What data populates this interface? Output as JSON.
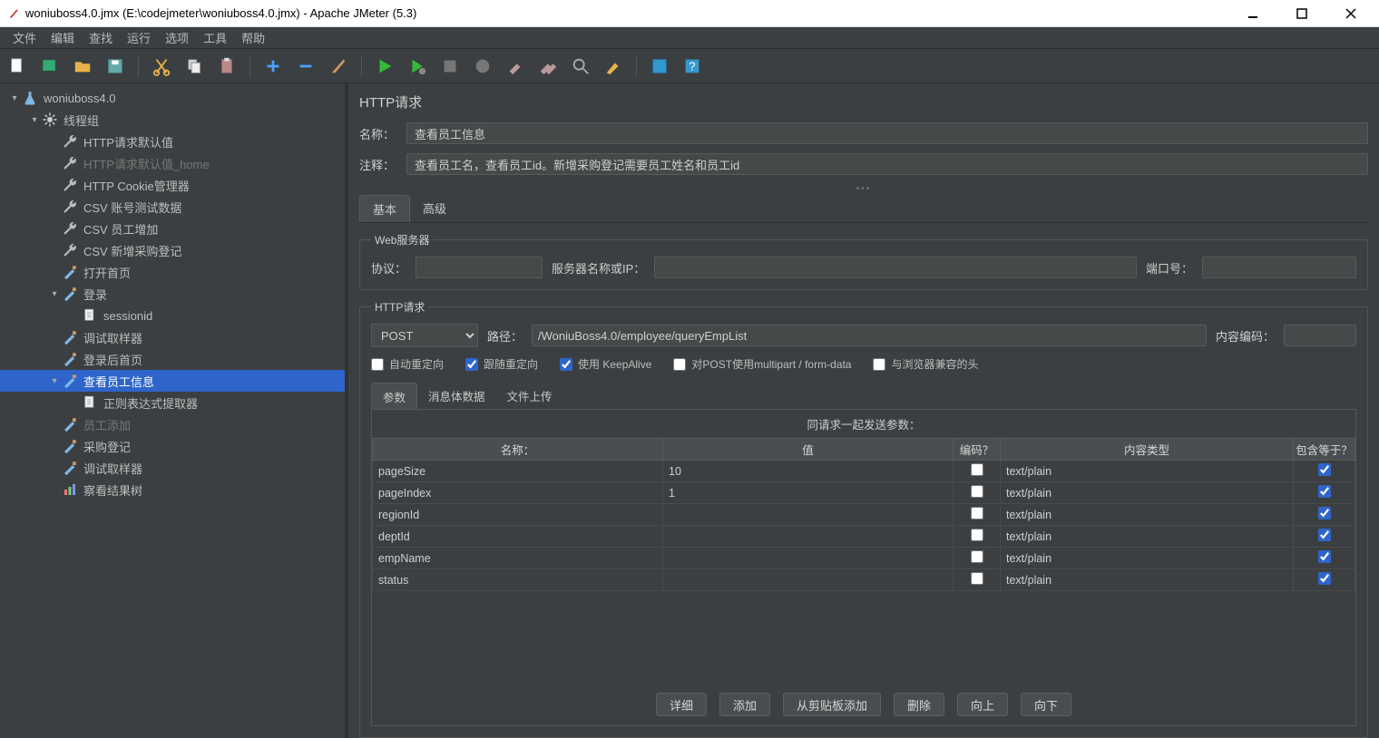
{
  "window": {
    "title": "woniuboss4.0.jmx (E:\\codejmeter\\woniuboss4.0.jmx) - Apache JMeter (5.3)"
  },
  "menu": {
    "items": [
      "文件",
      "编辑",
      "查找",
      "运行",
      "选项",
      "工具",
      "帮助"
    ]
  },
  "tree": {
    "items": [
      {
        "level": 0,
        "toggle": "▾",
        "icon": "flask",
        "label": "woniuboss4.0",
        "sel": false
      },
      {
        "level": 1,
        "toggle": "▾",
        "icon": "gear",
        "label": "线程组",
        "sel": false
      },
      {
        "level": 2,
        "toggle": "",
        "icon": "wrench",
        "label": "HTTP请求默认值",
        "sel": false
      },
      {
        "level": 2,
        "toggle": "",
        "icon": "wrench",
        "label": "HTTP请求默认值_home",
        "sel": false,
        "dim": true
      },
      {
        "level": 2,
        "toggle": "",
        "icon": "wrench",
        "label": "HTTP Cookie管理器",
        "sel": false
      },
      {
        "level": 2,
        "toggle": "",
        "icon": "wrench",
        "label": "CSV 账号测试数据",
        "sel": false
      },
      {
        "level": 2,
        "toggle": "",
        "icon": "wrench",
        "label": "CSV 员工增加",
        "sel": false
      },
      {
        "level": 2,
        "toggle": "",
        "icon": "wrench",
        "label": "CSV 新增采购登记",
        "sel": false
      },
      {
        "level": 2,
        "toggle": "",
        "icon": "sampler",
        "label": "打开首页",
        "sel": false
      },
      {
        "level": 2,
        "toggle": "▾",
        "icon": "sampler",
        "label": "登录",
        "sel": false
      },
      {
        "level": 3,
        "toggle": "",
        "icon": "note",
        "label": "sessionid",
        "sel": false
      },
      {
        "level": 2,
        "toggle": "",
        "icon": "sampler",
        "label": "调试取样器",
        "sel": false
      },
      {
        "level": 2,
        "toggle": "",
        "icon": "sampler",
        "label": "登录后首页",
        "sel": false
      },
      {
        "level": 2,
        "toggle": "▾",
        "icon": "sampler",
        "label": "查看员工信息",
        "sel": true
      },
      {
        "level": 3,
        "toggle": "",
        "icon": "note",
        "label": "正则表达式提取器",
        "sel": false
      },
      {
        "level": 2,
        "toggle": "",
        "icon": "sampler",
        "label": "员工添加",
        "sel": false,
        "dim": true
      },
      {
        "level": 2,
        "toggle": "",
        "icon": "sampler",
        "label": "采购登记",
        "sel": false
      },
      {
        "level": 2,
        "toggle": "",
        "icon": "sampler",
        "label": "调试取样器",
        "sel": false
      },
      {
        "level": 2,
        "toggle": "",
        "icon": "results",
        "label": "察看结果树",
        "sel": false
      }
    ]
  },
  "main": {
    "panel_title": "HTTP请求",
    "name_label": "名称：",
    "name_value": "查看员工信息",
    "comment_label": "注释：",
    "comment_value": "查看员工名，查看员工id。新增采购登记需要员工姓名和员工id",
    "tabs": {
      "basic": "基本",
      "advanced": "高级"
    },
    "web_server": {
      "legend": "Web服务器",
      "protocol_label": "协议：",
      "protocol_value": "",
      "server_label": "服务器名称或IP：",
      "server_value": "",
      "port_label": "端口号：",
      "port_value": ""
    },
    "http_request": {
      "legend": "HTTP请求",
      "method": "POST",
      "path_label": "路径：",
      "path_value": "/WoniuBoss4.0/employee/queryEmpList",
      "encoding_label": "内容编码：",
      "encoding_value": "",
      "cb_auto_redirect": "自动重定向",
      "cb_follow_redirect": "跟随重定向",
      "cb_keepalive": "使用 KeepAlive",
      "cb_multipart": "对POST使用multipart / form-data",
      "cb_browser_headers": "与浏览器兼容的头"
    },
    "subtabs": {
      "params": "参数",
      "body": "消息体数据",
      "files": "文件上传"
    },
    "param_table": {
      "caption": "同请求一起发送参数：",
      "headers": {
        "name": "名称：",
        "value": "值",
        "encode": "编码？",
        "ctype": "内容类型",
        "equals": "包含等于？"
      },
      "rows": [
        {
          "name": "pageSize",
          "value": "10",
          "encode": false,
          "ctype": "text/plain",
          "equals": true
        },
        {
          "name": "pageIndex",
          "value": "1",
          "encode": false,
          "ctype": "text/plain",
          "equals": true
        },
        {
          "name": "regionId",
          "value": "",
          "encode": false,
          "ctype": "text/plain",
          "equals": true
        },
        {
          "name": "deptId",
          "value": "",
          "encode": false,
          "ctype": "text/plain",
          "equals": true
        },
        {
          "name": "empName",
          "value": "",
          "encode": false,
          "ctype": "text/plain",
          "equals": true
        },
        {
          "name": "status",
          "value": "",
          "encode": false,
          "ctype": "text/plain",
          "equals": true
        }
      ]
    },
    "buttons": {
      "detail": "详细",
      "add": "添加",
      "from_clip": "从剪贴板添加",
      "delete": "删除",
      "up": "向上",
      "down": "向下"
    }
  }
}
